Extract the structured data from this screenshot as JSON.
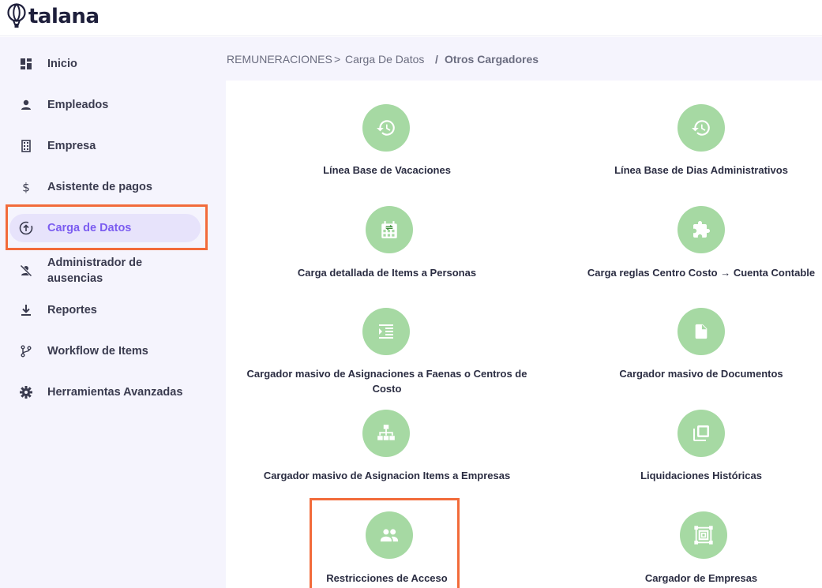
{
  "brand": {
    "name": "talana"
  },
  "sidebar": {
    "items": [
      {
        "label": "Inicio",
        "icon": "dashboard-icon"
      },
      {
        "label": "Empleados",
        "icon": "person-icon"
      },
      {
        "label": "Empresa",
        "icon": "building-icon"
      },
      {
        "label": "Asistente de pagos",
        "icon": "dollar-icon"
      },
      {
        "label": "Carga de Datos",
        "icon": "upload-circle-icon",
        "active": true
      },
      {
        "label": "Administrador de ausencias",
        "icon": "person-off-icon"
      },
      {
        "label": "Reportes",
        "icon": "download-icon"
      },
      {
        "label": "Workflow de Items",
        "icon": "branch-icon"
      },
      {
        "label": "Herramientas Avanzadas",
        "icon": "gear-icon"
      }
    ]
  },
  "breadcrumb": {
    "root": "REMUNERACIONES",
    "sep1": ">",
    "middle": "Carga De Datos",
    "sep2": "/",
    "current": "Otros Cargadores"
  },
  "cards": [
    {
      "label": "Línea Base de Vacaciones",
      "icon": "history-icon"
    },
    {
      "label": "Línea Base de Dias Administrativos",
      "icon": "history-icon"
    },
    {
      "label": "Carga detallada de Items a Personas",
      "icon": "calendar-swap-icon"
    },
    {
      "label": "Carga reglas Centro Costo → Cuenta Contable",
      "icon": "puzzle-icon"
    },
    {
      "label": "Cargador masivo de Asignaciones a Faenas o Centros de Costo",
      "icon": "indent-list-icon"
    },
    {
      "label": "Cargador masivo de Documentos",
      "icon": "document-icon"
    },
    {
      "label": "Cargador masivo de Asignacion Items a Empresas",
      "icon": "org-chart-icon"
    },
    {
      "label": "Liquidaciones Históricas",
      "icon": "copy-icon"
    },
    {
      "label": "Restricciones de Acceso",
      "icon": "people-icon"
    },
    {
      "label": "Cargador de Empresas",
      "icon": "frame-icon"
    }
  ],
  "colors": {
    "accent": "#7b5cf0",
    "icon_circle": "#a6d9a3",
    "highlight": "#f26b3a",
    "sidebar_bg": "#f5f4fd"
  }
}
